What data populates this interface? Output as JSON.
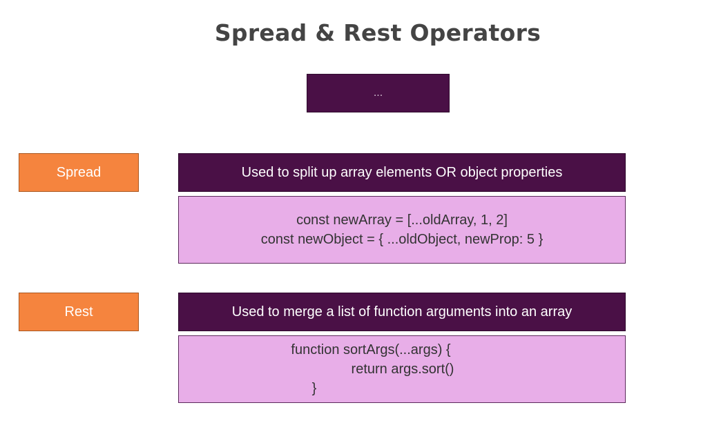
{
  "title": "Spread & Rest Operators",
  "operator": "...",
  "sections": [
    {
      "label": "Spread",
      "description": "Used to split up array elements OR object properties",
      "code_lines": [
        "const newArray = [...oldArray, 1, 2]",
        "const newObject = { ...oldObject, newProp: 5 }"
      ]
    },
    {
      "label": "Rest",
      "description": "Used to merge a list of function arguments into an array",
      "code_lines": [
        "function sortArgs(...args) {",
        "return args.sort()",
        "}"
      ]
    }
  ],
  "colors": {
    "dark_purple": "#4a1046",
    "orange": "#f5843e",
    "light_pink": "#e8aee8",
    "title_gray": "#444444"
  }
}
